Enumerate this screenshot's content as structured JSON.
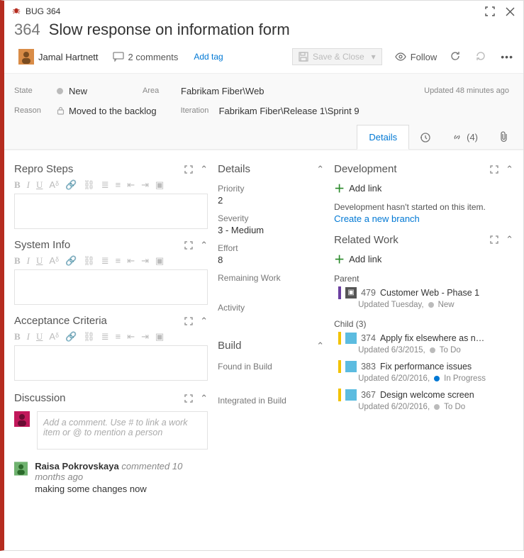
{
  "window": {
    "type_label": "BUG 364"
  },
  "work_item": {
    "id": "364",
    "title": "Slow response on information form",
    "assignee": "Jamal Hartnett",
    "comments_label": "2 comments",
    "add_tag": "Add tag",
    "save_label": "Save & Close",
    "follow_label": "Follow",
    "updated": "Updated 48 minutes ago"
  },
  "meta": {
    "state_label": "State",
    "state": "New",
    "reason_label": "Reason",
    "reason": "Moved to the backlog",
    "area_label": "Area",
    "area": "Fabrikam Fiber\\Web",
    "iteration_label": "Iteration",
    "iteration": "Fabrikam Fiber\\Release 1\\Sprint 9"
  },
  "tabs": {
    "details": "Details",
    "links_count": "(4)"
  },
  "sections": {
    "repro": "Repro Steps",
    "sysinfo": "System Info",
    "acceptance": "Acceptance Criteria",
    "discussion": "Discussion",
    "details": "Details",
    "build": "Build",
    "development": "Development",
    "related": "Related Work"
  },
  "details": {
    "priority_l": "Priority",
    "priority": "2",
    "severity_l": "Severity",
    "severity": "3 - Medium",
    "effort_l": "Effort",
    "effort": "8",
    "remaining_l": "Remaining Work",
    "remaining": "",
    "activity_l": "Activity",
    "activity": ""
  },
  "build": {
    "found_l": "Found in Build",
    "integrated_l": "Integrated in Build"
  },
  "development": {
    "add_link": "Add link",
    "hint": "Development hasn't started on this item.",
    "create_branch": "Create a new branch"
  },
  "related": {
    "add_link": "Add link",
    "parent_l": "Parent",
    "child_l": "Child (3)",
    "parent": {
      "id": "479",
      "title": "Customer Web - Phase 1",
      "updated": "Updated Tuesday,",
      "state": "New",
      "color": "#6b3fa0",
      "dot": "#bbb",
      "icon_bg": "#555"
    },
    "children": [
      {
        "id": "374",
        "title": "Apply fix elsewhere as n…",
        "updated": "Updated 6/3/2015,",
        "state": "To Do",
        "color": "#f2c200",
        "dot": "#bbb"
      },
      {
        "id": "383",
        "title": "Fix performance issues",
        "updated": "Updated 6/20/2016,",
        "state": "In Progress",
        "color": "#f2c200",
        "dot": "#0078d4"
      },
      {
        "id": "367",
        "title": "Design welcome screen",
        "updated": "Updated 6/20/2016,",
        "state": "To Do",
        "color": "#f2c200",
        "dot": "#bbb"
      }
    ]
  },
  "discussion": {
    "placeholder": "Add a comment. Use # to link a work item or @ to mention a person",
    "items": [
      {
        "author": "Raisa Pokrovskaya",
        "meta": "commented 10 months ago",
        "text": "making some changes now"
      }
    ]
  }
}
